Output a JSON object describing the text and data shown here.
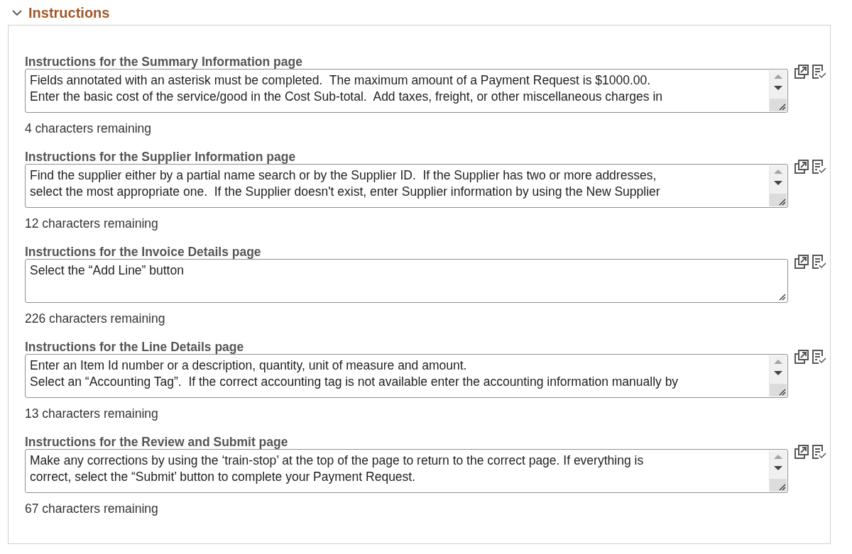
{
  "section": {
    "title": "Instructions",
    "expanded": true
  },
  "fields": [
    {
      "label": "Instructions for the Summary Information page",
      "lines": [
        "Fields annotated with an asterisk must be completed.  The maximum amount of a Payment Request is $1000.00.",
        "Enter the basic cost of the service/good in the Cost Sub-total.  Add taxes, freight, or other miscellaneous charges in"
      ],
      "scrollbar": true,
      "remaining": "4 characters remaining"
    },
    {
      "label": "Instructions for the Supplier Information page",
      "lines": [
        "Find the supplier either by a partial name search or by the Supplier ID.  If the Supplier has two or more addresses,",
        "select the most appropriate one.  If the Supplier doesn't exist, enter Supplier information by using the New Supplier"
      ],
      "scrollbar": true,
      "remaining": "12 characters remaining"
    },
    {
      "label": "Instructions for the Invoice Details page",
      "lines": [
        "Select the “Add Line” button"
      ],
      "scrollbar": false,
      "remaining": "226 characters remaining"
    },
    {
      "label": "Instructions for the Line Details page",
      "lines": [
        "Enter an Item Id number or a description, quantity, unit of measure and amount.",
        "Select an “Accounting Tag”.  If the correct accounting tag is not available enter the accounting information manually by"
      ],
      "scrollbar": true,
      "remaining": "13 characters remaining"
    },
    {
      "label": "Instructions for the Review and Submit page",
      "lines": [
        "Make any corrections by using the ‘train-stop’ at the top of the page to return to the correct page. If everything is",
        "correct, select the “Submit’ button to complete your Payment Request."
      ],
      "scrollbar": true,
      "remaining": "67 characters remaining"
    }
  ]
}
